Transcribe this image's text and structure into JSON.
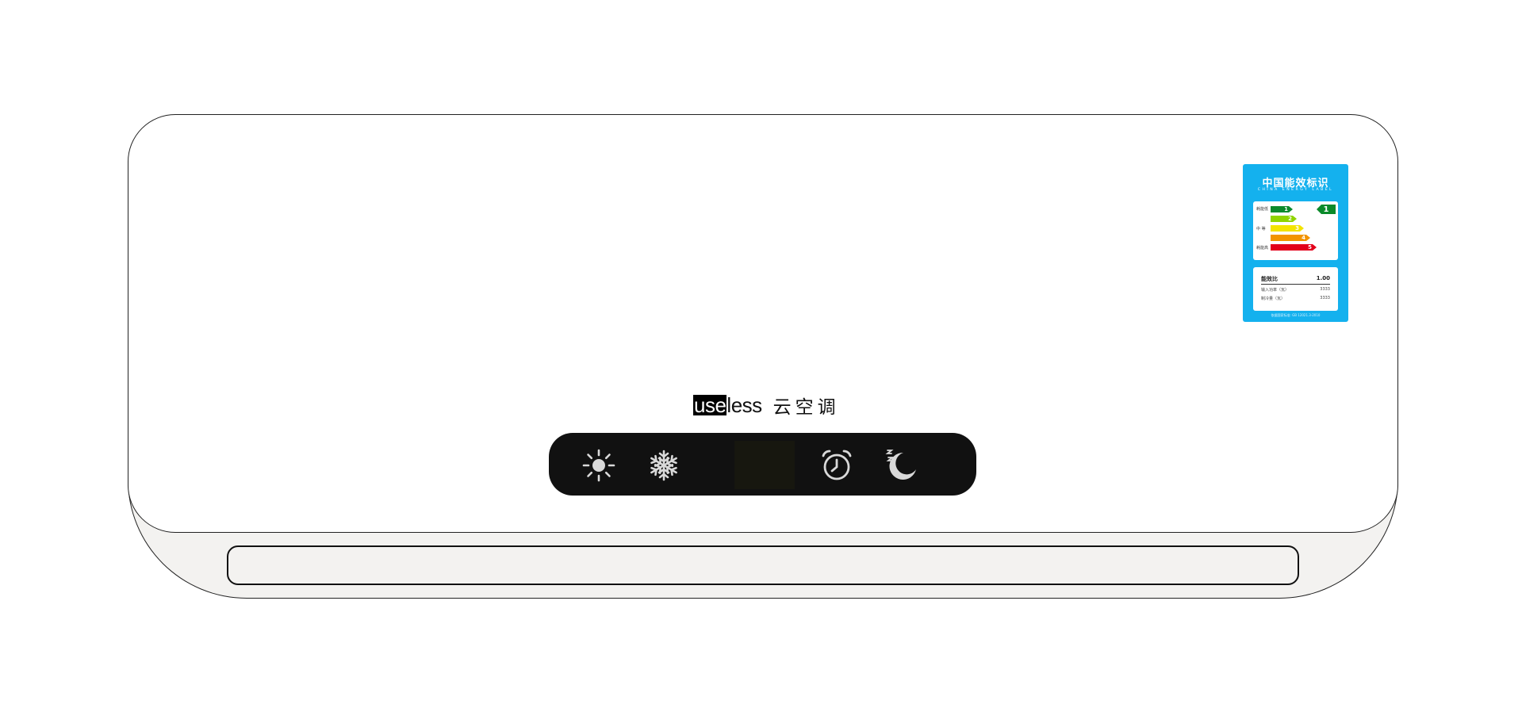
{
  "brand": {
    "logo_highlight": "use",
    "logo_rest": "less",
    "name": "云空调"
  },
  "panel": {
    "buttons": [
      {
        "id": "heat",
        "icon": "sun-icon"
      },
      {
        "id": "cool",
        "icon": "snowflake-icon"
      },
      {
        "id": "timer",
        "icon": "alarm-clock-icon"
      },
      {
        "id": "sleep",
        "icon": "moon-icon"
      }
    ],
    "display_value": ""
  },
  "energy_label": {
    "title": "中国能效标识",
    "subtitle": "CHINA ENERGY LABEL",
    "side_low": "耗能低",
    "side_mid": "中 等",
    "side_high": "耗能高",
    "grades": [
      "1",
      "2",
      "3",
      "4",
      "5"
    ],
    "grade_colors": [
      "#0c8a2c",
      "#8fd400",
      "#f3e400",
      "#f29400",
      "#e3001b"
    ],
    "current_grade": "1",
    "efficiency_label": "能效比",
    "efficiency_value": "1.00",
    "input_power_label": "输入功率（瓦）",
    "input_power_value": "3333",
    "cooling_label": "制冷量（瓦）",
    "cooling_value": "3333",
    "footer": "依据国家标准: GB 12021.3-2010"
  },
  "colors": {
    "panel_bg": "#111111",
    "icon_color": "#d9d9d9",
    "label_blue": "#14b1ee"
  }
}
